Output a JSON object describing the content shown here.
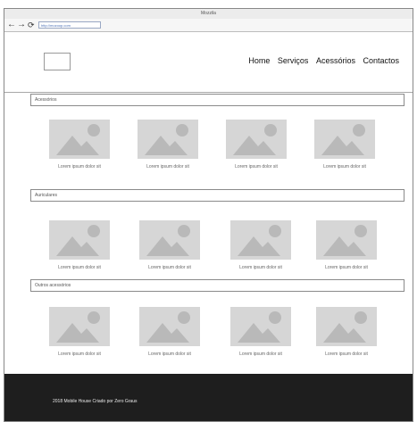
{
  "window": {
    "title": "Mozzila"
  },
  "toolbar": {
    "back_icon": "arrow-left",
    "forward_icon": "arrow-right",
    "reload_icon": "reload",
    "url": "http://mozoop.com"
  },
  "nav": {
    "items": [
      "Home",
      "Serviços",
      "Acessórios",
      "Contactos"
    ]
  },
  "sections": [
    {
      "title": "Acessórios",
      "items": [
        "Lorem ipsum dolor sit",
        "Lorem ipsum dolor sit",
        "Lorem ipsum dolor sit",
        "Lorem ipsum dolor sit"
      ]
    },
    {
      "title": "Auriculares",
      "items": [
        "Lorem ipsum dolor sit",
        "Lorem ipsum dolor sit",
        "Lorem ipsum dolor sit",
        "Lorem ipsum dolor sit"
      ]
    },
    {
      "title": "Outros acessórios",
      "items": [
        "Lorem ipsum dolor sit",
        "Lorem ipsum dolor sit",
        "Lorem ipsum dolor sit",
        "Lorem ipsum dolor sit"
      ]
    }
  ],
  "footer": {
    "text": "2018 Mobile House Criado por Zero Graus"
  },
  "colors": {
    "footer_bg": "#1e1e1e",
    "placeholder": "#d6d6d6",
    "placeholder_icon": "#b9b9b9"
  }
}
